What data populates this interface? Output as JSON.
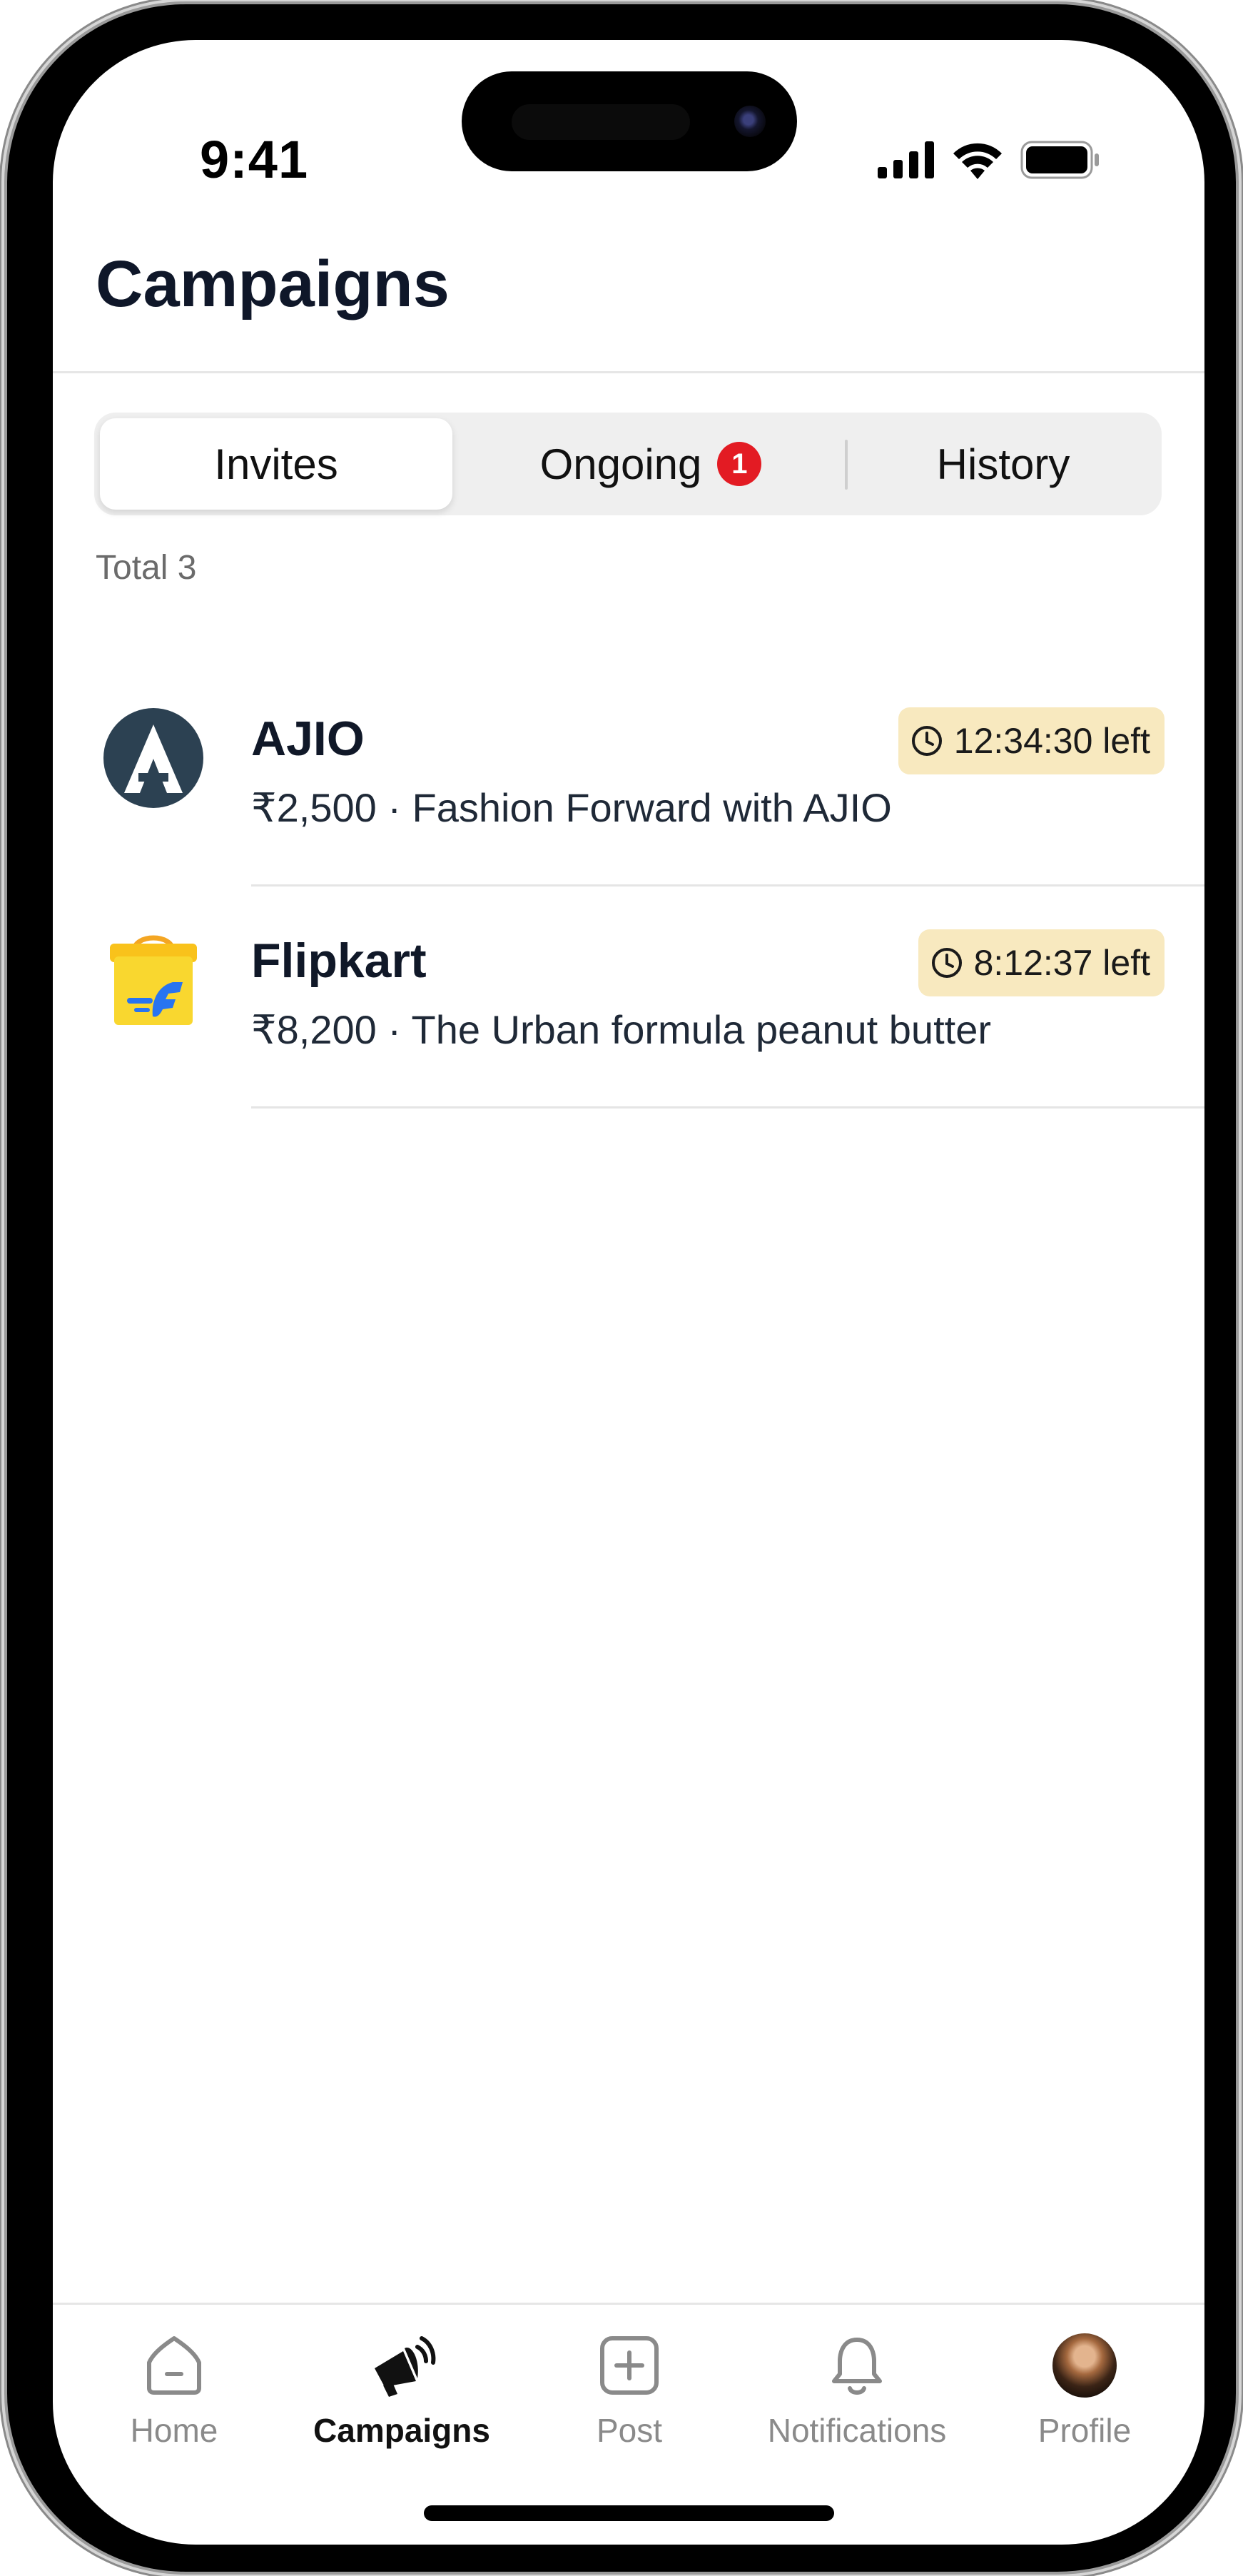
{
  "status_bar": {
    "time": "9:41"
  },
  "header": {
    "title": "Campaigns"
  },
  "tabs": [
    {
      "label": "Invites",
      "active": true
    },
    {
      "label": "Ongoing",
      "badge": "1"
    },
    {
      "label": "History"
    }
  ],
  "list": {
    "total_label": "Total 3",
    "items": [
      {
        "brand": "AJIO",
        "subtitle": "₹2,500 · Fashion Forward with AJIO",
        "time_left": "12:34:30 left",
        "logo_icon": "ajio-logo"
      },
      {
        "brand": "Flipkart",
        "subtitle": "₹8,200 · The Urban formula peanut butter",
        "time_left": "8:12:37 left",
        "logo_icon": "flipkart-logo"
      }
    ]
  },
  "bottom_nav": [
    {
      "label": "Home",
      "icon": "home-icon"
    },
    {
      "label": "Campaigns",
      "icon": "megaphone-icon",
      "active": true
    },
    {
      "label": "Post",
      "icon": "plus-square-icon"
    },
    {
      "label": "Notifications",
      "icon": "bell-icon"
    },
    {
      "label": "Profile",
      "icon": "avatar"
    }
  ],
  "colors": {
    "badge": "#e31b23",
    "timer_bg": "#f8e9bf",
    "title": "#0f1729",
    "inactive_nav": "#8a8a8a"
  }
}
